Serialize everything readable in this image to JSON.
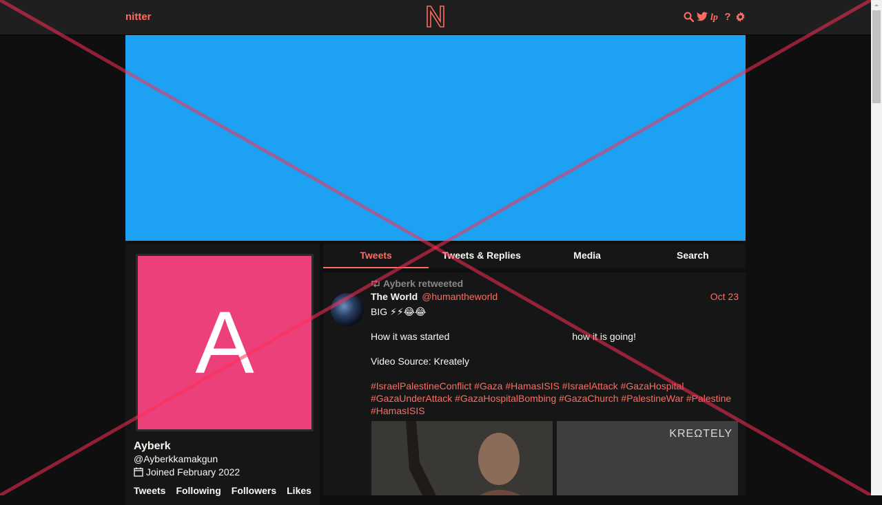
{
  "nav": {
    "brand": "nitter",
    "logo_letter": "N",
    "icons": [
      "search-icon",
      "twitter-icon",
      "rss-icon",
      "help-icon",
      "settings-icon"
    ],
    "help_label": "?"
  },
  "colors": {
    "accent": "#ff6c60",
    "banner": "#1da1f2",
    "avatar_bg": "#ec407a",
    "background": "#0f0f0f",
    "card": "#161616"
  },
  "profile": {
    "avatar_letter": "A",
    "fullname": "Ayberk",
    "username": "@Ayberkkamakgun",
    "joined": "Joined February 2022",
    "stats": [
      "Tweets",
      "Following",
      "Followers",
      "Likes"
    ]
  },
  "tabs": [
    "Tweets",
    "Tweets & Replies",
    "Media",
    "Search"
  ],
  "tweet": {
    "retweet_label": "Ayberk retweeted",
    "fullname": "The World",
    "username": "@humantheworld",
    "date": "Oct 23",
    "line1": "BIG ⚡⚡😂😂",
    "line2a": "How it was started",
    "line2b": "how it is going!",
    "line3": "Video Source: Kreately",
    "hashtags": "#IsraelPalestineConflict #Gaza #HamasISIS #IsraelAttack #GazaHospital #GazaUnderAttack #GazaHospitalBombing #GazaChurch #PalestineWar #Palestine #HamasISIS",
    "media_brand": "KREΩTELY"
  }
}
